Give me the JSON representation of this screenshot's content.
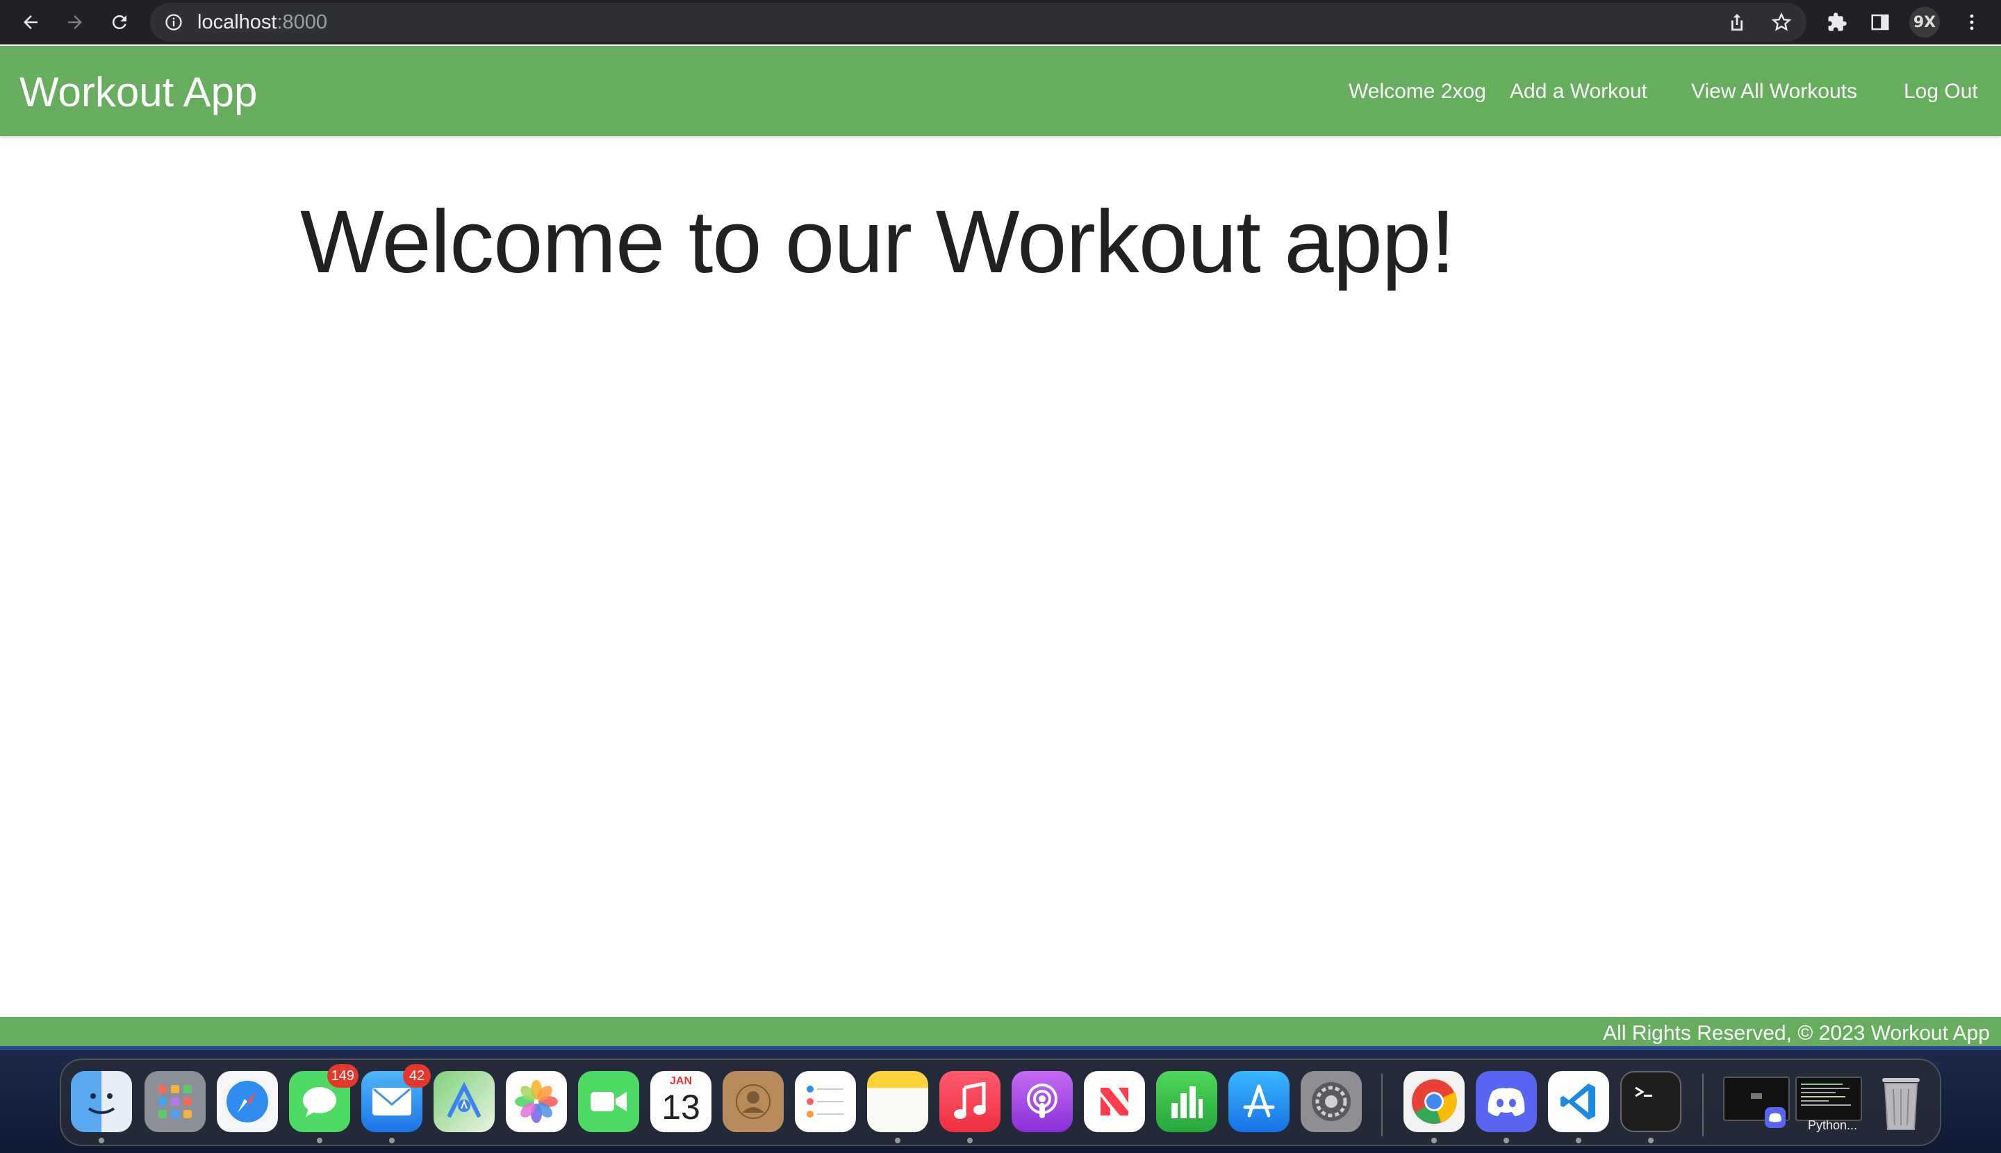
{
  "browser": {
    "url_host": "localhost",
    "url_port": ":8000",
    "profile_initials": "9X"
  },
  "site": {
    "brand": "Workout App",
    "nav": {
      "welcome": "Welcome 2xog",
      "add_workout": "Add a Workout",
      "view_all": "View All Workouts",
      "logout": "Log Out"
    },
    "hero_title": "Welcome to our Workout app!",
    "footer": "All Rights Reserved, © 2023 Workout App",
    "accent_color": "#66ad5e"
  },
  "dock": {
    "apps": [
      {
        "name": "Finder",
        "icon": "finder-icon",
        "running": true
      },
      {
        "name": "Launchpad",
        "icon": "launchpad-icon",
        "running": false
      },
      {
        "name": "Safari",
        "icon": "safari-icon",
        "running": false
      },
      {
        "name": "Messages",
        "icon": "messages-icon",
        "running": true,
        "badge": "149"
      },
      {
        "name": "Mail",
        "icon": "mail-icon",
        "running": true,
        "badge": "42"
      },
      {
        "name": "Maps",
        "icon": "maps-icon",
        "running": false
      },
      {
        "name": "Photos",
        "icon": "photos-icon",
        "running": false
      },
      {
        "name": "FaceTime",
        "icon": "facetime-icon",
        "running": false
      },
      {
        "name": "Calendar",
        "icon": "calendar-icon",
        "running": false,
        "month": "JAN",
        "day": "13"
      },
      {
        "name": "Contacts",
        "icon": "contacts-icon",
        "running": false
      },
      {
        "name": "Reminders",
        "icon": "reminders-icon",
        "running": false
      },
      {
        "name": "Notes",
        "icon": "notes-icon",
        "running": true
      },
      {
        "name": "Music",
        "icon": "music-icon",
        "running": true
      },
      {
        "name": "Podcasts",
        "icon": "podcasts-icon",
        "running": false
      },
      {
        "name": "News",
        "icon": "news-icon",
        "running": false
      },
      {
        "name": "Numbers",
        "icon": "numbers-icon",
        "running": false
      },
      {
        "name": "App Store",
        "icon": "app-store-icon",
        "running": false
      },
      {
        "name": "System Settings",
        "icon": "system-settings-icon",
        "running": false
      },
      {
        "name": "Chrome",
        "icon": "chrome-icon",
        "running": true
      },
      {
        "name": "Discord",
        "icon": "discord-icon",
        "running": true
      },
      {
        "name": "VS Code",
        "icon": "vscode-icon",
        "running": true
      },
      {
        "name": "Terminal",
        "icon": "terminal-icon",
        "running": true
      }
    ],
    "minimized_label": "Python..."
  }
}
